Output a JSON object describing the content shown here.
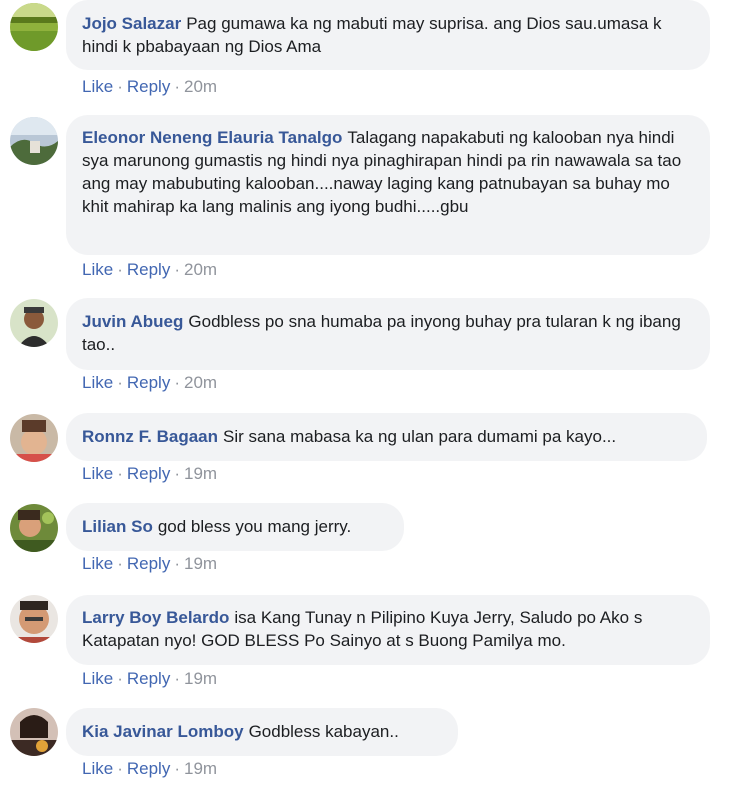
{
  "comments": [
    {
      "author": "Jojo Salazar",
      "text": "Pag gumawa ka ng mabuti may suprisa. ang Dios sau.umasa k hindi k pbabayaan ng Dios Ama",
      "like": "Like",
      "reply": "Reply",
      "time": "20m"
    },
    {
      "author": "Eleonor Neneng Elauria Tanalgo",
      "text": "Talagang napakabuti ng kalooban nya hindi sya marunong gumastis ng hindi nya pinaghirapan hindi pa rin nawawala sa tao ang may mabubuting kalooban....naway laging kang patnubayan sa buhay mo khit mahirap ka lang malinis ang iyong budhi.....gbu",
      "like": "Like",
      "reply": "Reply",
      "time": "20m"
    },
    {
      "author": "Juvin Abueg",
      "text": "Godbless po sna humaba pa inyong buhay pra tularan k ng ibang tao..",
      "like": "Like",
      "reply": "Reply",
      "time": "20m"
    },
    {
      "author": "Ronnz F. Bagaan",
      "text": "Sir sana mabasa ka ng ulan para dumami pa kayo...",
      "like": "Like",
      "reply": "Reply",
      "time": "19m"
    },
    {
      "author": "Lilian So",
      "text": "god bless you mang jerry.",
      "like": "Like",
      "reply": "Reply",
      "time": "19m"
    },
    {
      "author": "Larry Boy Belardo",
      "text": "isa Kang Tunay n Pilipino Kuya Jerry, Saludo po Ako s Katapatan nyo! GOD BLESS Po Sainyo at s Buong Pamilya mo.",
      "like": "Like",
      "reply": "Reply",
      "time": "19m"
    },
    {
      "author": "Kia Javinar Lomboy",
      "text": "Godbless kabayan..",
      "like": "Like",
      "reply": "Reply",
      "time": "19m"
    }
  ],
  "colors": {
    "author": "#385898",
    "link": "#4267b2",
    "meta": "#90949c",
    "bubble": "#f2f3f5"
  }
}
